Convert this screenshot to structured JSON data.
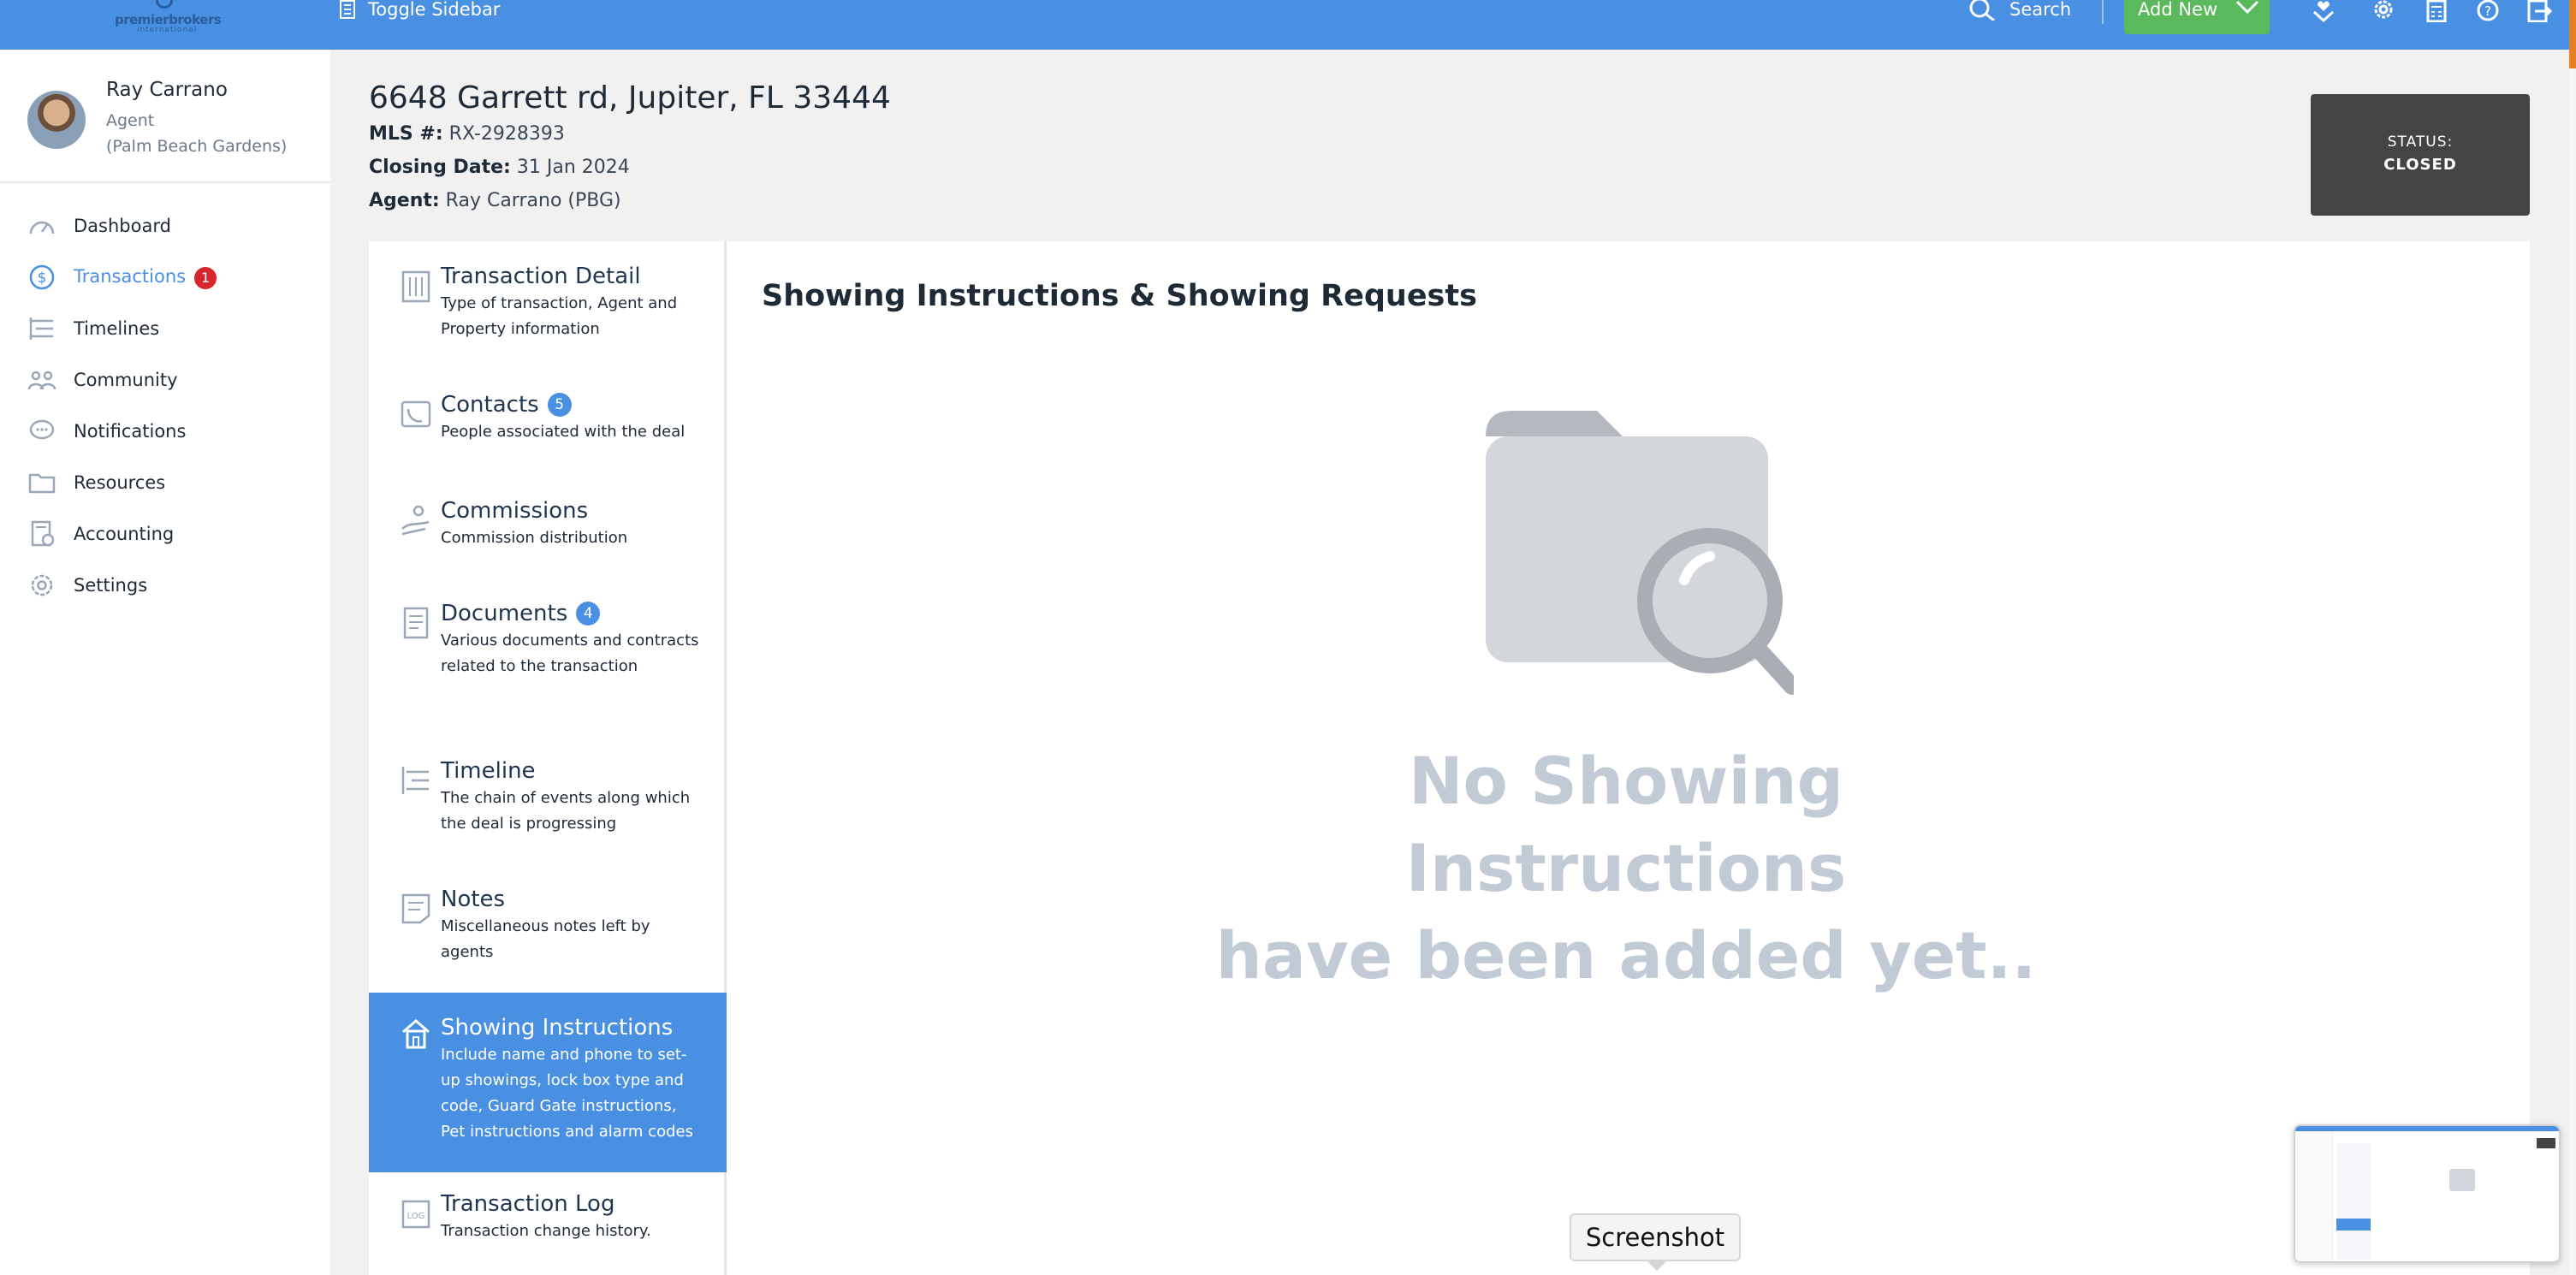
{
  "topbar": {
    "logo_word": "premierbrokers",
    "logo_sub": "international",
    "toggle_label": "Toggle Sidebar",
    "search_label": "Search",
    "add_new_label": "Add New"
  },
  "user": {
    "name": "Ray Carrano",
    "role": "Agent",
    "office": "(Palm Beach Gardens)"
  },
  "nav": [
    {
      "label": "Dashboard",
      "icon": "dashboard-icon"
    },
    {
      "label": "Transactions",
      "icon": "transactions-icon",
      "badge": "1"
    },
    {
      "label": "Timelines",
      "icon": "timelines-icon"
    },
    {
      "label": "Community",
      "icon": "community-icon"
    },
    {
      "label": "Notifications",
      "icon": "notifications-icon"
    },
    {
      "label": "Resources",
      "icon": "resources-icon"
    },
    {
      "label": "Accounting",
      "icon": "accounting-icon"
    },
    {
      "label": "Settings",
      "icon": "settings-icon"
    }
  ],
  "property": {
    "address": "6648 Garrett rd, Jupiter, FL 33444",
    "mls_label": "MLS #:",
    "mls_value": "RX-2928393",
    "closing_label": "Closing Date:",
    "closing_value": "31 Jan 2024",
    "agent_label": "Agent:",
    "agent_value": "Ray Carrano (PBG)"
  },
  "status": {
    "label": "STATUS:",
    "value": "CLOSED"
  },
  "menu": [
    {
      "title": "Transaction Detail",
      "desc": "Type of transaction, Agent and Property information"
    },
    {
      "title": "Contacts",
      "badge": "5",
      "desc": "People associated with the deal"
    },
    {
      "title": "Commissions",
      "desc": "Commission distribution"
    },
    {
      "title": "Documents",
      "badge": "4",
      "desc": "Various documents and contracts related to the transaction"
    },
    {
      "title": "Timeline",
      "desc": "The chain of events along which the deal is progressing"
    },
    {
      "title": "Notes",
      "desc": "Miscellaneous notes left by agents"
    },
    {
      "title": "Showing Instructions",
      "desc": "Include name and phone to set-up showings, lock box type and code, Guard Gate instructions, Pet instructions and alarm codes"
    },
    {
      "title": "Transaction Log",
      "desc": "Transaction change history."
    }
  ],
  "content": {
    "title": "Showing Instructions & Showing Requests",
    "empty_line1": "No Showing Instructions",
    "empty_line2": "have been added yet.."
  },
  "tooltip": "Screenshot",
  "colors": {
    "topbar": "#4a90e2",
    "accent": "#4a90e2",
    "add_new": "#5cb85c",
    "badge_red": "#d9262c",
    "status_bg": "#444444"
  }
}
